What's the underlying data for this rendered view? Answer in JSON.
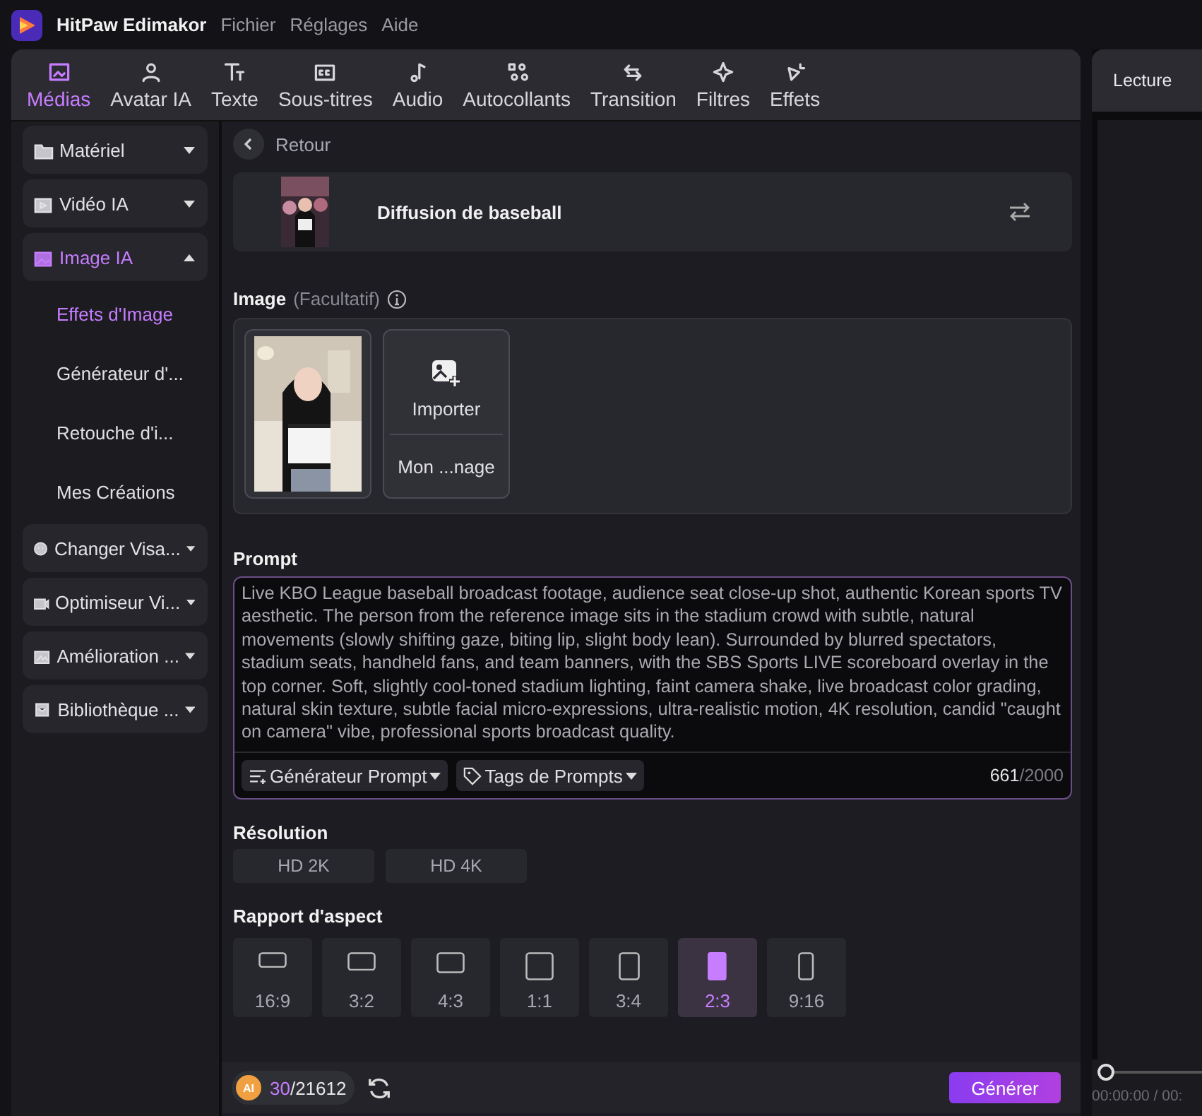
{
  "app": {
    "title": "HitPaw Edimakor",
    "menu": [
      "Fichier",
      "Réglages",
      "Aide"
    ]
  },
  "toolbar": {
    "tabs": [
      {
        "label": "Médias",
        "selected": true
      },
      {
        "label": "Avatar IA",
        "selected": false
      },
      {
        "label": "Texte",
        "selected": false
      },
      {
        "label": "Sous-titres",
        "selected": false
      },
      {
        "label": "Audio",
        "selected": false
      },
      {
        "label": "Autocollants",
        "selected": false
      },
      {
        "label": "Transition",
        "selected": false
      },
      {
        "label": "Filtres",
        "selected": false
      },
      {
        "label": "Effets",
        "selected": false
      }
    ]
  },
  "sidebar": {
    "items": [
      {
        "label": "Matériel",
        "selected": false,
        "expanded": false
      },
      {
        "label": "Vidéo IA",
        "selected": false,
        "expanded": false
      },
      {
        "label": "Image IA",
        "selected": true,
        "expanded": true,
        "children": [
          {
            "label": "Effets d'Image",
            "selected": true
          },
          {
            "label": "Générateur d'...",
            "selected": false
          },
          {
            "label": "Retouche d'i...",
            "selected": false
          },
          {
            "label": "Mes Créations",
            "selected": false
          }
        ]
      },
      {
        "label": "Changer Visa...",
        "selected": false,
        "expanded": false
      },
      {
        "label": "Optimiseur Vi...",
        "selected": false,
        "expanded": false
      },
      {
        "label": "Amélioration ...",
        "selected": false,
        "expanded": false
      },
      {
        "label": "Bibliothèque ...",
        "selected": false,
        "expanded": false
      }
    ]
  },
  "back": {
    "label": "Retour"
  },
  "template": {
    "title": "Diffusion de baseball"
  },
  "image_section": {
    "label": "Image",
    "hint": "(Facultatif)",
    "import_label": "Importer",
    "source_label": "Mon ...nage"
  },
  "prompt": {
    "label": "Prompt",
    "value": "Live KBO League baseball broadcast footage, audience seat close-up shot, authentic Korean sports TV aesthetic. The person from the reference image sits in the stadium crowd with subtle, natural movements (slowly shifting gaze, biting lip, slight body lean). Surrounded by blurred spectators, stadium seats, handheld fans, and team banners, with the SBS Sports LIVE scoreboard overlay in the top corner. Soft, slightly cool-toned stadium lighting, faint camera shake, live broadcast color grading, natural skin texture, subtle facial micro-expressions, ultra-realistic motion, 4K resolution, candid \"caught on camera\" vibe, professional sports broadcast quality.",
    "tools": [
      "Générateur Prompt",
      "Tags de Prompts"
    ],
    "count": "661",
    "limit": "/2000"
  },
  "resolution": {
    "label": "Résolution",
    "options": [
      {
        "label": "HD 2K",
        "selected": false
      },
      {
        "label": "HD 4K",
        "selected": false
      }
    ]
  },
  "aspect": {
    "label": "Rapport d'aspect",
    "options": [
      {
        "label": "16:9",
        "selected": false
      },
      {
        "label": "3:2",
        "selected": false
      },
      {
        "label": "4:3",
        "selected": false
      },
      {
        "label": "1:1",
        "selected": false
      },
      {
        "label": "3:4",
        "selected": false
      },
      {
        "label": "2:3",
        "selected": true
      },
      {
        "label": "9:16",
        "selected": false
      }
    ]
  },
  "footer": {
    "coin": "AI",
    "credits_used": "30",
    "credits_total": "/21612",
    "generate": "Générer"
  },
  "preview": {
    "title": "Lecture",
    "level": 0,
    "timecode": "00:00:00 / 00:"
  }
}
